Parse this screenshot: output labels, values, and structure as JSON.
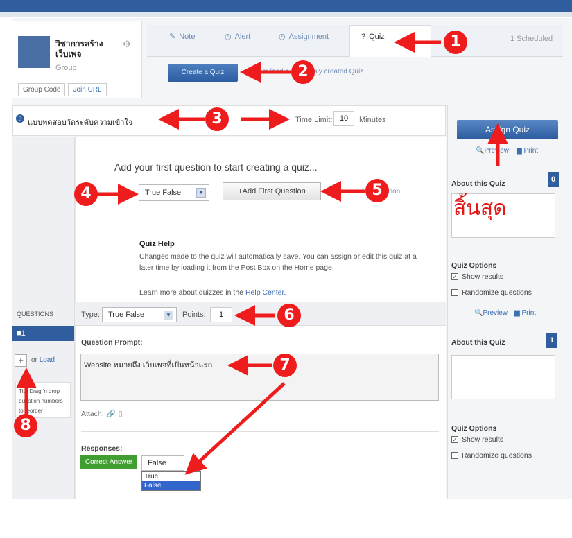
{
  "group": {
    "name": "วิชาการสร้าง เว็บเพจ",
    "type": "Group",
    "tabs": [
      "Group Code",
      "Join URL"
    ]
  },
  "post_tabs": {
    "note": "Note",
    "alert": "Alert",
    "assignment": "Assignment",
    "quiz": "Quiz",
    "scheduled": "1 Scheduled"
  },
  "create_quiz": {
    "button": "Create a Quiz",
    "previous_link": "or load a previously created Quiz"
  },
  "quiz_header": {
    "title": "แบบทดสอบวัดระดับความเข้าใจ",
    "time_limit_label": "Time Limit:",
    "time_limit_value": "10",
    "minutes_label": "Minutes"
  },
  "editor": {
    "add_first_heading": "Add your first question to start creating a quiz...",
    "type_value": "True False",
    "add_first_button": "+Add First Question",
    "first_question_link": "First Question"
  },
  "help": {
    "title": "Quiz Help",
    "text": "Changes made to the quiz will automatically save. You can assign or edit this quiz at a later time by loading it from the Post Box on the Home page.",
    "learn_prefix": "Learn more about quizzes in the",
    "learn_link": "Help Center."
  },
  "right_panel": {
    "assign_button": "Assign Quiz",
    "preview": "Preview",
    "print": "Print",
    "about_title": "About this Quiz",
    "badge_top": "0",
    "badge_bottom": "1",
    "options_title": "Quiz Options",
    "show_results": "Show results",
    "randomize": "Randomize questions",
    "thai_label": "สิ้นสุด"
  },
  "questions_panel": {
    "label": "QUESTIONS",
    "item": "1",
    "add": "+",
    "or": "or",
    "load": "Load",
    "tip": "Tip: Drag 'n drop question numbers to reorder"
  },
  "question": {
    "type_label": "Type:",
    "type_value": "True False",
    "points_label": "Points:",
    "points_value": "1",
    "prompt_label": "Question Prompt:",
    "prompt_text": "Website หมายถึง เว็บเพจที่เป็นหน้าแรก",
    "attach_label": "Attach:",
    "responses_label": "Responses:",
    "correct_answer": "Correct Answer",
    "answer_value": "False",
    "options": [
      "True",
      "False"
    ]
  },
  "annotations": [
    "1",
    "2",
    "3",
    "4",
    "5",
    "6",
    "7",
    "8"
  ],
  "colors": {
    "accent": "#2f5d9e",
    "annotation": "#ee1c1c",
    "correct": "#3f9e2f"
  }
}
